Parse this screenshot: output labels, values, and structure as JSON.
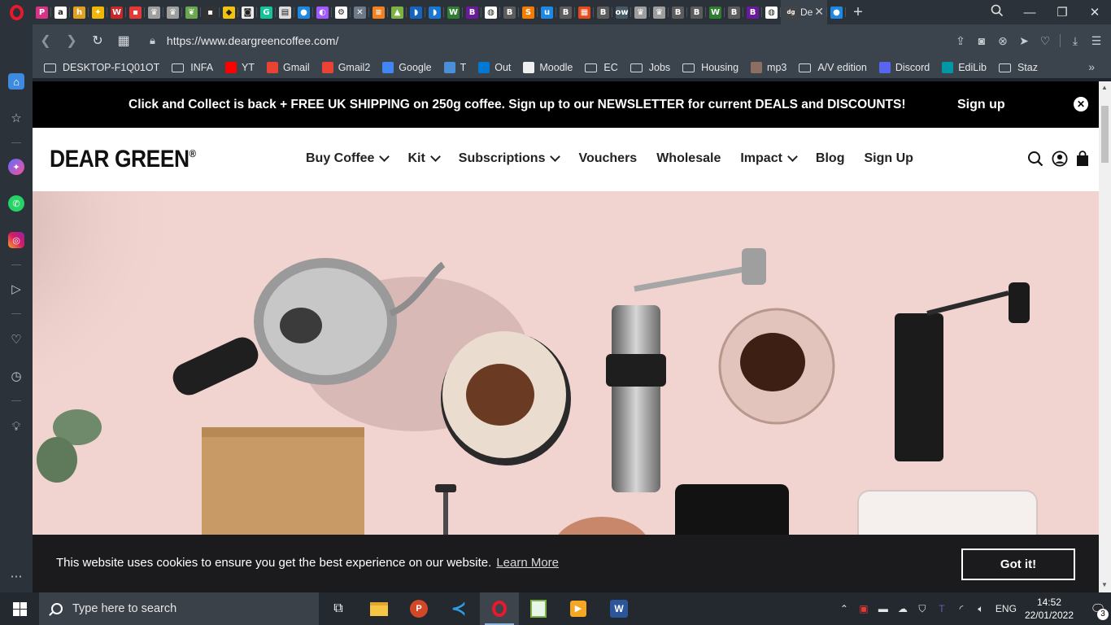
{
  "browser": {
    "tabs": [
      {
        "icon": "p-icon",
        "color": "#d63384",
        "glyph": "P"
      },
      {
        "icon": "amazon-icon",
        "color": "#ffffff",
        "glyph": "a"
      },
      {
        "icon": "h-icon",
        "color": "#e0a020",
        "glyph": "h"
      },
      {
        "icon": "pinwheel-icon",
        "color": "#f2b705",
        "glyph": "✦"
      },
      {
        "icon": "w-icon",
        "color": "#c62828",
        "glyph": "W"
      },
      {
        "icon": "doc-icon",
        "color": "#e53935",
        "glyph": "▪"
      },
      {
        "icon": "crown-icon",
        "color": "#9e9e9e",
        "glyph": "♛"
      },
      {
        "icon": "crown-icon",
        "color": "#9e9e9e",
        "glyph": "♛"
      },
      {
        "icon": "leaf-icon",
        "color": "#6aa84f",
        "glyph": "❦"
      },
      {
        "icon": "dark-icon",
        "color": "#333333",
        "glyph": "▪"
      },
      {
        "icon": "y-icon",
        "color": "#f1c40f",
        "glyph": "◆"
      },
      {
        "icon": "camera-icon",
        "color": "#eeeeee",
        "glyph": "◙"
      },
      {
        "icon": "grammarly-icon",
        "color": "#15c39a",
        "glyph": "G"
      },
      {
        "icon": "news-icon",
        "color": "#dddddd",
        "glyph": "▤"
      },
      {
        "icon": "blue-icon",
        "color": "#1e88e5",
        "glyph": "●"
      },
      {
        "icon": "figma-icon",
        "color": "#a259ff",
        "glyph": "◐"
      },
      {
        "icon": "gear-icon",
        "color": "#ffffff",
        "glyph": "⚙"
      },
      {
        "icon": "x-icon",
        "color": "#6c7a89",
        "glyph": "✕"
      },
      {
        "icon": "stack-icon",
        "color": "#f48024",
        "glyph": "≡"
      },
      {
        "icon": "tri-icon",
        "color": "#7cb342",
        "glyph": "▲"
      },
      {
        "icon": "bird-icon",
        "color": "#1565c0",
        "glyph": "◗"
      },
      {
        "icon": "wing-icon",
        "color": "#1976d2",
        "glyph": "◗"
      },
      {
        "icon": "w-green-icon",
        "color": "#2e7d32",
        "glyph": "W"
      },
      {
        "icon": "b-icon",
        "color": "#6a1b9a",
        "glyph": "B"
      },
      {
        "icon": "globe-icon",
        "color": "#ffffff",
        "glyph": "◍"
      },
      {
        "icon": "b-icon",
        "color": "#5c5c5c",
        "glyph": "B"
      },
      {
        "icon": "s-icon",
        "color": "#f57c00",
        "glyph": "S"
      },
      {
        "icon": "u3-icon",
        "color": "#1e88e5",
        "glyph": "u"
      },
      {
        "icon": "b-icon",
        "color": "#5c5c5c",
        "glyph": "B"
      },
      {
        "icon": "office-icon",
        "color": "#e64a19",
        "glyph": "▦"
      },
      {
        "icon": "b-icon",
        "color": "#5c5c5c",
        "glyph": "B"
      },
      {
        "icon": "ow-icon",
        "color": "#455a64",
        "glyph": "ow"
      },
      {
        "icon": "crown-icon",
        "color": "#9e9e9e",
        "glyph": "♛"
      },
      {
        "icon": "crown-icon",
        "color": "#9e9e9e",
        "glyph": "♛"
      },
      {
        "icon": "b-icon",
        "color": "#5c5c5c",
        "glyph": "B"
      },
      {
        "icon": "b-icon",
        "color": "#5c5c5c",
        "glyph": "B"
      },
      {
        "icon": "w-green-icon",
        "color": "#2e7d32",
        "glyph": "W"
      },
      {
        "icon": "b-icon",
        "color": "#5c5c5c",
        "glyph": "B"
      },
      {
        "icon": "b-icon",
        "color": "#6a1b9a",
        "glyph": "B"
      },
      {
        "icon": "globe-icon",
        "color": "#ffffff",
        "glyph": "◍"
      }
    ],
    "active_tab_title": "De",
    "url": "https://www.deargreencoffee.com/",
    "bookmarks": [
      {
        "label": "DESKTOP-F1Q01OT",
        "type": "folder"
      },
      {
        "label": "INFA",
        "type": "folder"
      },
      {
        "label": "YT",
        "type": "youtube",
        "color": "#ff0000"
      },
      {
        "label": "Gmail",
        "type": "icon",
        "color": "#ea4335"
      },
      {
        "label": "Gmail2",
        "type": "icon",
        "color": "#ea4335"
      },
      {
        "label": "Google",
        "type": "icon",
        "color": "#4285f4"
      },
      {
        "label": "T",
        "type": "icon",
        "color": "#4a90d9"
      },
      {
        "label": "Out",
        "type": "icon",
        "color": "#0078d4"
      },
      {
        "label": "Moodle",
        "type": "icon",
        "color": "#f0f0f0"
      },
      {
        "label": "EC",
        "type": "folder"
      },
      {
        "label": "Jobs",
        "type": "folder"
      },
      {
        "label": "Housing",
        "type": "folder"
      },
      {
        "label": "mp3",
        "type": "icon",
        "color": "#8d6e63"
      },
      {
        "label": "A/V edition",
        "type": "folder"
      },
      {
        "label": "Discord",
        "type": "icon",
        "color": "#5865f2"
      },
      {
        "label": "EdiLib",
        "type": "icon",
        "color": "#0097a7"
      },
      {
        "label": "Staz",
        "type": "folder"
      }
    ]
  },
  "announcement": {
    "message": "Click and Collect is back + FREE UK SHIPPING on 250g coffee. Sign up to our NEWSLETTER for current DEALS and DISCOUNTS!",
    "cta": "Sign up",
    "close": "✕"
  },
  "header": {
    "logo": "DEAR GREEN",
    "logo_mark": "®",
    "nav": [
      {
        "label": "Buy Coffee",
        "dropdown": true
      },
      {
        "label": "Kit",
        "dropdown": true
      },
      {
        "label": "Subscriptions",
        "dropdown": true
      },
      {
        "label": "Vouchers",
        "dropdown": false
      },
      {
        "label": "Wholesale",
        "dropdown": false
      },
      {
        "label": "Impact",
        "dropdown": true
      },
      {
        "label": "Blog",
        "dropdown": false
      },
      {
        "label": "Sign Up",
        "dropdown": false
      }
    ]
  },
  "cookie": {
    "message": "This website uses cookies to ensure you get the best experience on our website.",
    "learn_more": "Learn More",
    "accept": "Got it!"
  },
  "taskbar": {
    "search_placeholder": "Type here to search",
    "language": "ENG",
    "time": "14:52",
    "date": "22/01/2022",
    "notification_count": "3"
  },
  "colors": {
    "hero_bg": "#f1d3cf",
    "announce_bg": "#000000",
    "cookie_bg": "#1b1b1d",
    "chrome_dark": "#2b323a",
    "chrome_mid": "#3b434c"
  }
}
